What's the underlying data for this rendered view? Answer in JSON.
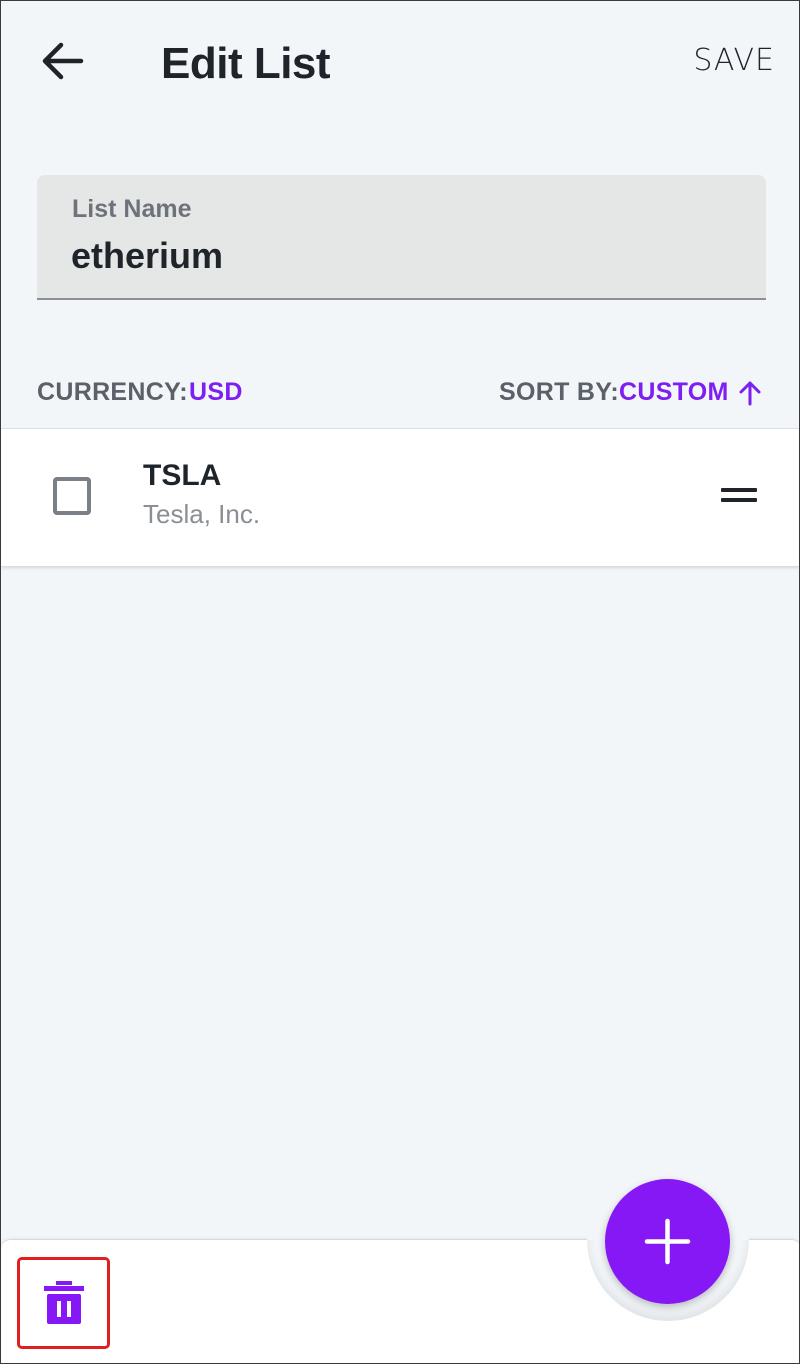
{
  "header": {
    "title": "Edit List",
    "save_label": "SAVE",
    "back_icon": "arrow-left-icon"
  },
  "list_name_field": {
    "label": "List Name",
    "value": "etherium"
  },
  "options": {
    "currency_label": "CURRENCY:",
    "currency_value": "USD",
    "sort_label": "SORT BY:",
    "sort_value": "CUSTOM",
    "sort_icon": "arrow-up-icon"
  },
  "items": [
    {
      "ticker": "TSLA",
      "company": "Tesla, Inc.",
      "checked": false
    }
  ],
  "bottom_bar": {
    "add_icon": "plus-icon",
    "delete_icon": "trash-icon"
  },
  "colors": {
    "accent": "#8618f6",
    "accent_text": "#7d1ef2",
    "background": "#f3f6f9",
    "text_primary": "#1f242b",
    "text_secondary": "#8a8e95",
    "highlight_border": "#e02020"
  }
}
